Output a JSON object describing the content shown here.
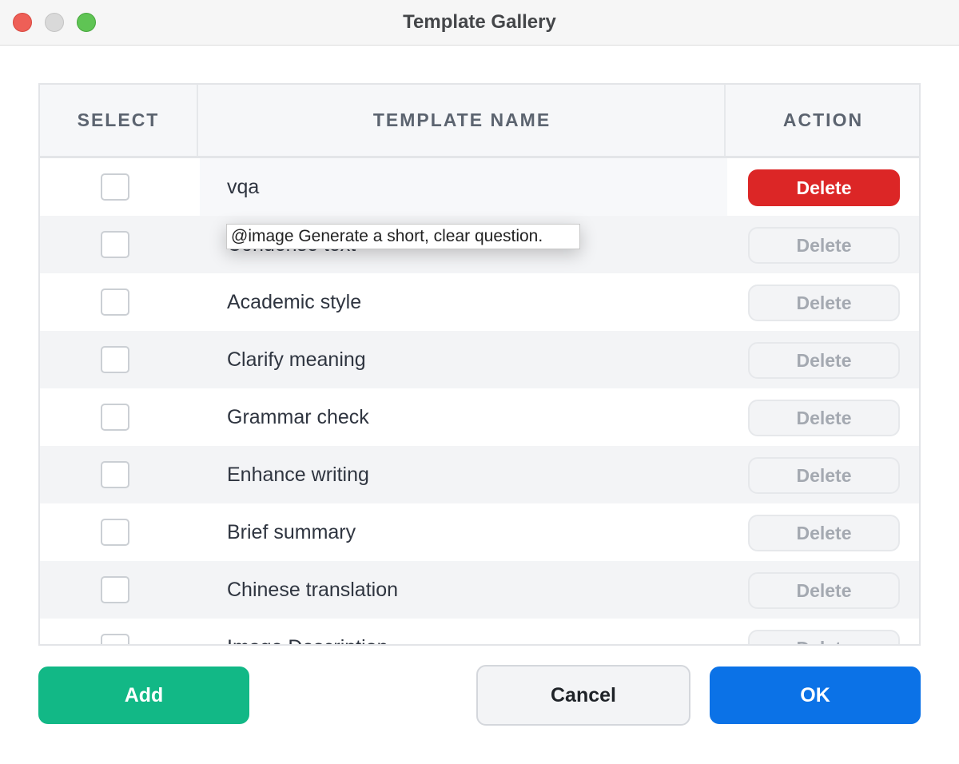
{
  "window": {
    "title": "Template Gallery"
  },
  "table": {
    "headers": {
      "select": "SELECT",
      "name": "TEMPLATE NAME",
      "action": "ACTION"
    },
    "rows": [
      {
        "name": "vqa",
        "action_label": "Delete",
        "selected": false,
        "action_state": "active"
      },
      {
        "name": "Condense text",
        "action_label": "Delete",
        "selected": false,
        "action_state": "inactive"
      },
      {
        "name": "Academic style",
        "action_label": "Delete",
        "selected": false,
        "action_state": "inactive"
      },
      {
        "name": "Clarify meaning",
        "action_label": "Delete",
        "selected": false,
        "action_state": "inactive"
      },
      {
        "name": "Grammar check",
        "action_label": "Delete",
        "selected": false,
        "action_state": "inactive"
      },
      {
        "name": "Enhance writing",
        "action_label": "Delete",
        "selected": false,
        "action_state": "inactive"
      },
      {
        "name": "Brief summary",
        "action_label": "Delete",
        "selected": false,
        "action_state": "inactive"
      },
      {
        "name": "Chinese translation",
        "action_label": "Delete",
        "selected": false,
        "action_state": "inactive"
      },
      {
        "name": "Image Description",
        "action_label": "Delete",
        "selected": false,
        "action_state": "inactive"
      }
    ]
  },
  "tooltip": {
    "text": "@image Generate a short, clear question."
  },
  "footer": {
    "add_label": "Add",
    "cancel_label": "Cancel",
    "ok_label": "OK"
  },
  "colors": {
    "danger": "#dc2626",
    "success": "#12b886",
    "primary": "#0b72e7"
  }
}
